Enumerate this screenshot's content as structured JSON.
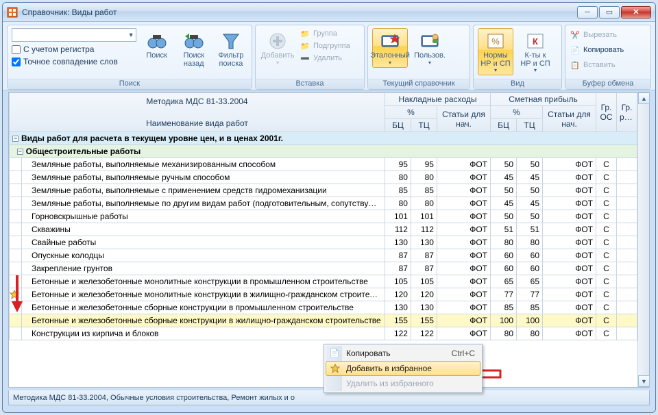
{
  "window": {
    "title": "Справочник: Виды работ"
  },
  "ribbon": {
    "groups": {
      "search": {
        "title": "Поиск",
        "chk_register": "С учетом регистра",
        "chk_exact": "Точное совпадение слов",
        "btn_search": "Поиск",
        "btn_back": "Поиск\nназад",
        "btn_filter": "Фильтр\nпоиска"
      },
      "insert": {
        "title": "Вставка",
        "btn_add": "Добавить",
        "item_group": "Группа",
        "item_subgroup": "Подгруппа",
        "item_delete": "Удалить"
      },
      "current": {
        "title": "Текущий справочник",
        "btn_reference": "Эталонный",
        "btn_user": "Пользов."
      },
      "view": {
        "title": "Вид",
        "btn_norms": "Нормы\nНР и СП",
        "btn_coeffs": "К-ты к\nНР и СП"
      },
      "clipboard": {
        "title": "Буфер обмена",
        "item_cut": "Вырезать",
        "item_copy": "Копировать",
        "item_paste": "Вставить"
      }
    }
  },
  "grid": {
    "method_title": "Методика МДС 81-33.2004",
    "header": {
      "name": "Наименование вида работ",
      "overhead": "Накладные расходы",
      "profit": "Сметная прибыль",
      "percent": "%",
      "articles": "Статьи для\nнач.",
      "bc": "БЦ",
      "tc": "ТЦ",
      "group_os": "Гр.\nОС",
      "group_res": "Гр.\nрес."
    },
    "section_a": "Виды работ для расчета в текущем уровне цен, и в ценах 2001г.",
    "section_b": "Общестроительные работы",
    "rows": [
      {
        "name": "Земляные работы, выполняемые механизированным способом",
        "nr_bc": 95,
        "nr_tc": 95,
        "nr_art": "ФОТ",
        "sp_bc": 50,
        "sp_tc": 50,
        "sp_art": "ФОТ",
        "gr": "С"
      },
      {
        "name": "Земляные работы, выполняемые ручным способом",
        "nr_bc": 80,
        "nr_tc": 80,
        "nr_art": "ФОТ",
        "sp_bc": 45,
        "sp_tc": 45,
        "sp_art": "ФОТ",
        "gr": "С"
      },
      {
        "name": "Земляные работы, выполняемые с применением средств гидромеханизации",
        "nr_bc": 85,
        "nr_tc": 85,
        "nr_art": "ФОТ",
        "sp_bc": 50,
        "sp_tc": 50,
        "sp_art": "ФОТ",
        "gr": "С"
      },
      {
        "name": "Земляные работы, выполняемые по другим видам работ (подготовительным, сопутствующим, укрепительным)",
        "nr_bc": 80,
        "nr_tc": 80,
        "nr_art": "ФОТ",
        "sp_bc": 45,
        "sp_tc": 45,
        "sp_art": "ФОТ",
        "gr": "С",
        "wrap": true
      },
      {
        "name": "Горновскрышные работы",
        "nr_bc": 101,
        "nr_tc": 101,
        "nr_art": "ФОТ",
        "sp_bc": 50,
        "sp_tc": 50,
        "sp_art": "ФОТ",
        "gr": "С"
      },
      {
        "name": "Скважины",
        "nr_bc": 112,
        "nr_tc": 112,
        "nr_art": "ФОТ",
        "sp_bc": 51,
        "sp_tc": 51,
        "sp_art": "ФОТ",
        "gr": "С"
      },
      {
        "name": "Свайные работы",
        "nr_bc": 130,
        "nr_tc": 130,
        "nr_art": "ФОТ",
        "sp_bc": 80,
        "sp_tc": 80,
        "sp_art": "ФОТ",
        "gr": "С"
      },
      {
        "name": "Опускные колодцы",
        "nr_bc": 87,
        "nr_tc": 87,
        "nr_art": "ФОТ",
        "sp_bc": 60,
        "sp_tc": 60,
        "sp_art": "ФОТ",
        "gr": "С"
      },
      {
        "name": "Закрепление грунтов",
        "nr_bc": 87,
        "nr_tc": 87,
        "nr_art": "ФОТ",
        "sp_bc": 60,
        "sp_tc": 60,
        "sp_art": "ФОТ",
        "gr": "С"
      },
      {
        "name": "Бетонные и железобетонные монолитные конструкции в промышленном строительстве",
        "nr_bc": 105,
        "nr_tc": 105,
        "nr_art": "ФОТ",
        "sp_bc": 65,
        "sp_tc": 65,
        "sp_art": "ФОТ",
        "gr": "С",
        "wrap": true
      },
      {
        "name": "Бетонные и железобетонные монолитные конструкции в жилищно-гражданском строительстве",
        "nr_bc": 120,
        "nr_tc": 120,
        "nr_art": "ФОТ",
        "sp_bc": 77,
        "sp_tc": 77,
        "sp_art": "ФОТ",
        "gr": "С",
        "wrap": true,
        "star": true
      },
      {
        "name": "Бетонные и железобетонные сборные конструкции в промышленном строительстве",
        "nr_bc": 130,
        "nr_tc": 130,
        "nr_art": "ФОТ",
        "sp_bc": 85,
        "sp_tc": 85,
        "sp_art": "ФОТ",
        "gr": "С"
      },
      {
        "name": "Бетонные и железобетонные сборные конструкции в жилищно-гражданском строительстве",
        "nr_bc": 155,
        "nr_tc": 155,
        "nr_art": "ФОТ",
        "sp_bc": 100,
        "sp_tc": 100,
        "sp_art": "ФОТ",
        "gr": "С",
        "wrap": true,
        "hl": true
      },
      {
        "name": "Конструкции из кирпича и блоков",
        "nr_bc": 122,
        "nr_tc": 122,
        "nr_art": "ФОТ",
        "sp_bc": 80,
        "sp_tc": 80,
        "sp_art": "ФОТ",
        "gr": "С"
      }
    ]
  },
  "context_menu": {
    "copy": "Копировать",
    "copy_shortcut": "Ctrl+C",
    "add_fav": "Добавить в избранное",
    "del_fav": "Удалить из избранного"
  },
  "statusbar": "Методика МДС 81-33.2004, Обычные условия строительства, Ремонт жилых и о"
}
